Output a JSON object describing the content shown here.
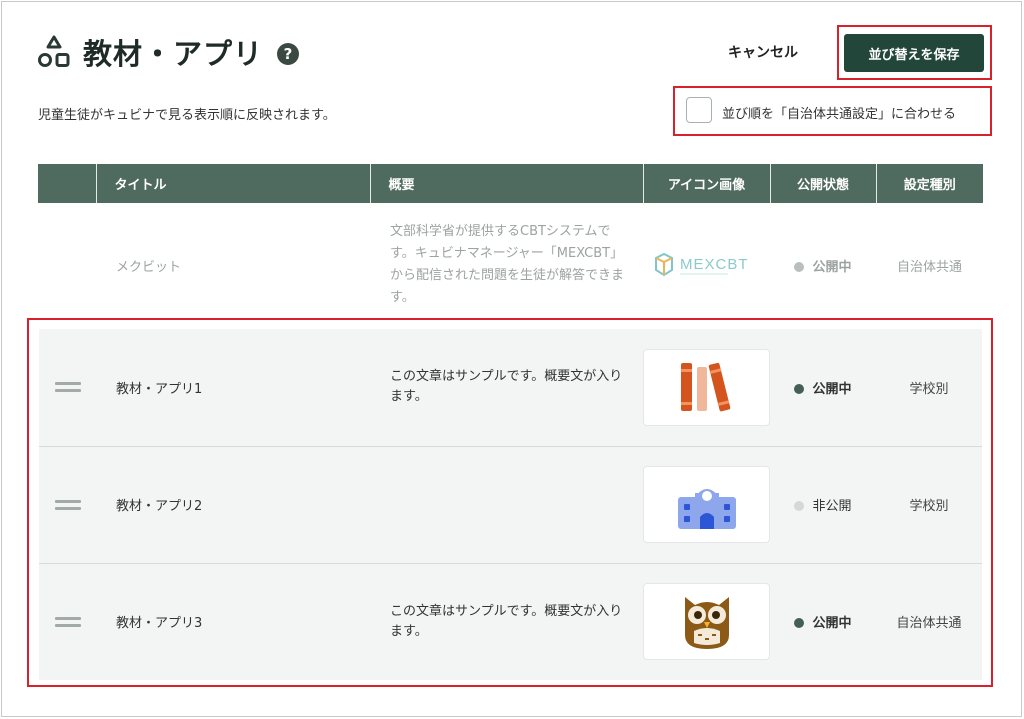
{
  "header": {
    "title": "教材・アプリ",
    "help_icon_glyph": "?",
    "cancel_label": "キャンセル",
    "save_label": "並び替えを保存",
    "description": "児童生徒がキュビナで見る表示順に反映されます。",
    "sync_label": "並び順を「自治体共通設定」に合わせる",
    "sync_checked": false
  },
  "table": {
    "columns": [
      "",
      "タイトル",
      "概要",
      "アイコン画像",
      "公開状態",
      "設定種別"
    ],
    "rows": [
      {
        "title": "メクビット",
        "summary": "文部科学省が提供するCBTシステムです。キュビナマネージャー「MEXCBT」から配信された問題を生徒が解答できます。",
        "icon": "mexcbt-logo-icon",
        "icon_text": "MEXCBT",
        "status": "公開中",
        "type": "自治体共通",
        "draggable": false
      },
      {
        "title": "教材・アプリ1",
        "summary": "この文章はサンプルです。概要文が入ります。",
        "icon": "books-icon",
        "status": "公開中",
        "type": "学校別",
        "draggable": true
      },
      {
        "title": "教材・アプリ2",
        "summary": "",
        "icon": "school-building-icon",
        "status": "非公開",
        "type": "学校別",
        "draggable": true
      },
      {
        "title": "教材・アプリ3",
        "summary": "この文章はサンプルです。概要文が入ります。",
        "icon": "owl-icon",
        "status": "公開中",
        "type": "自治体共通",
        "draggable": true
      }
    ]
  },
  "colors": {
    "header_bg": "#4f6b60",
    "save_button_bg": "#22463a",
    "highlight_border": "#d7212b",
    "public_dot": "#445f55",
    "private_dot": "#d4d8d6"
  }
}
